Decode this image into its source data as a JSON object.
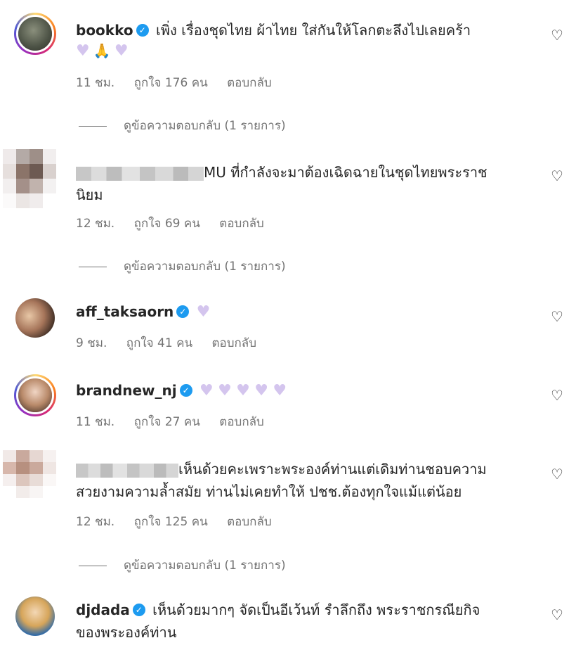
{
  "comments": [
    {
      "username": "bookko",
      "verified": true,
      "text": "เพิ่ง เรื่องชุดไทย ผ้าไทย ใส่กันให้โลกตะลึงไปเลยคร้า",
      "time": "11 ชม.",
      "likes": "ถูกใจ 176 คน",
      "reply": "ตอบกลับ",
      "view_replies": "ดูข้อความตอบกลับ (1 รายการ)"
    },
    {
      "username": "",
      "verified": false,
      "text": "MU ที่กำลังจะมาต้องเฉิดฉายในชุดไทยพระราช",
      "text2": "นิยม",
      "time": "12 ชม.",
      "likes": "ถูกใจ 69 คน",
      "reply": "ตอบกลับ",
      "view_replies": "ดูข้อความตอบกลับ (1 รายการ)"
    },
    {
      "username": "aff_taksaorn",
      "verified": true,
      "text": "",
      "time": "9 ชม.",
      "likes": "ถูกใจ 41 คน",
      "reply": "ตอบกลับ"
    },
    {
      "username": "brandnew_nj",
      "verified": true,
      "text": "",
      "time": "11 ชม.",
      "likes": "ถูกใจ 27 คน",
      "reply": "ตอบกลับ"
    },
    {
      "username": "",
      "verified": false,
      "text": "เห็นด้วยคะเพราะพระองค์ท่านแต่เดิมท่านชอบความ",
      "text2": "สวยงามความล้ำสมัย ท่านไม่เคยทำให้ ปชช.ต้องทุกใจแม้แต่น้อย",
      "time": "12 ชม.",
      "likes": "ถูกใจ 125 คน",
      "reply": "ตอบกลับ",
      "view_replies": "ดูข้อความตอบกลับ (1 รายการ)"
    },
    {
      "username": "djdada",
      "verified": true,
      "text": "เห็นด้วยมากๆ จัดเป็นอีเว้นท์ รำลึกถึง พระราชกรณียกิจ",
      "text2": "ของพระองค์ท่าน"
    }
  ],
  "colors": {
    "verified": "#1d9bf0",
    "heart_emoji": "#d4c5ee",
    "meta": "#737373"
  },
  "icons": {
    "like": "heart-outline-icon",
    "verified": "verified-badge-icon",
    "emoji": "purple-heart-emoji"
  }
}
